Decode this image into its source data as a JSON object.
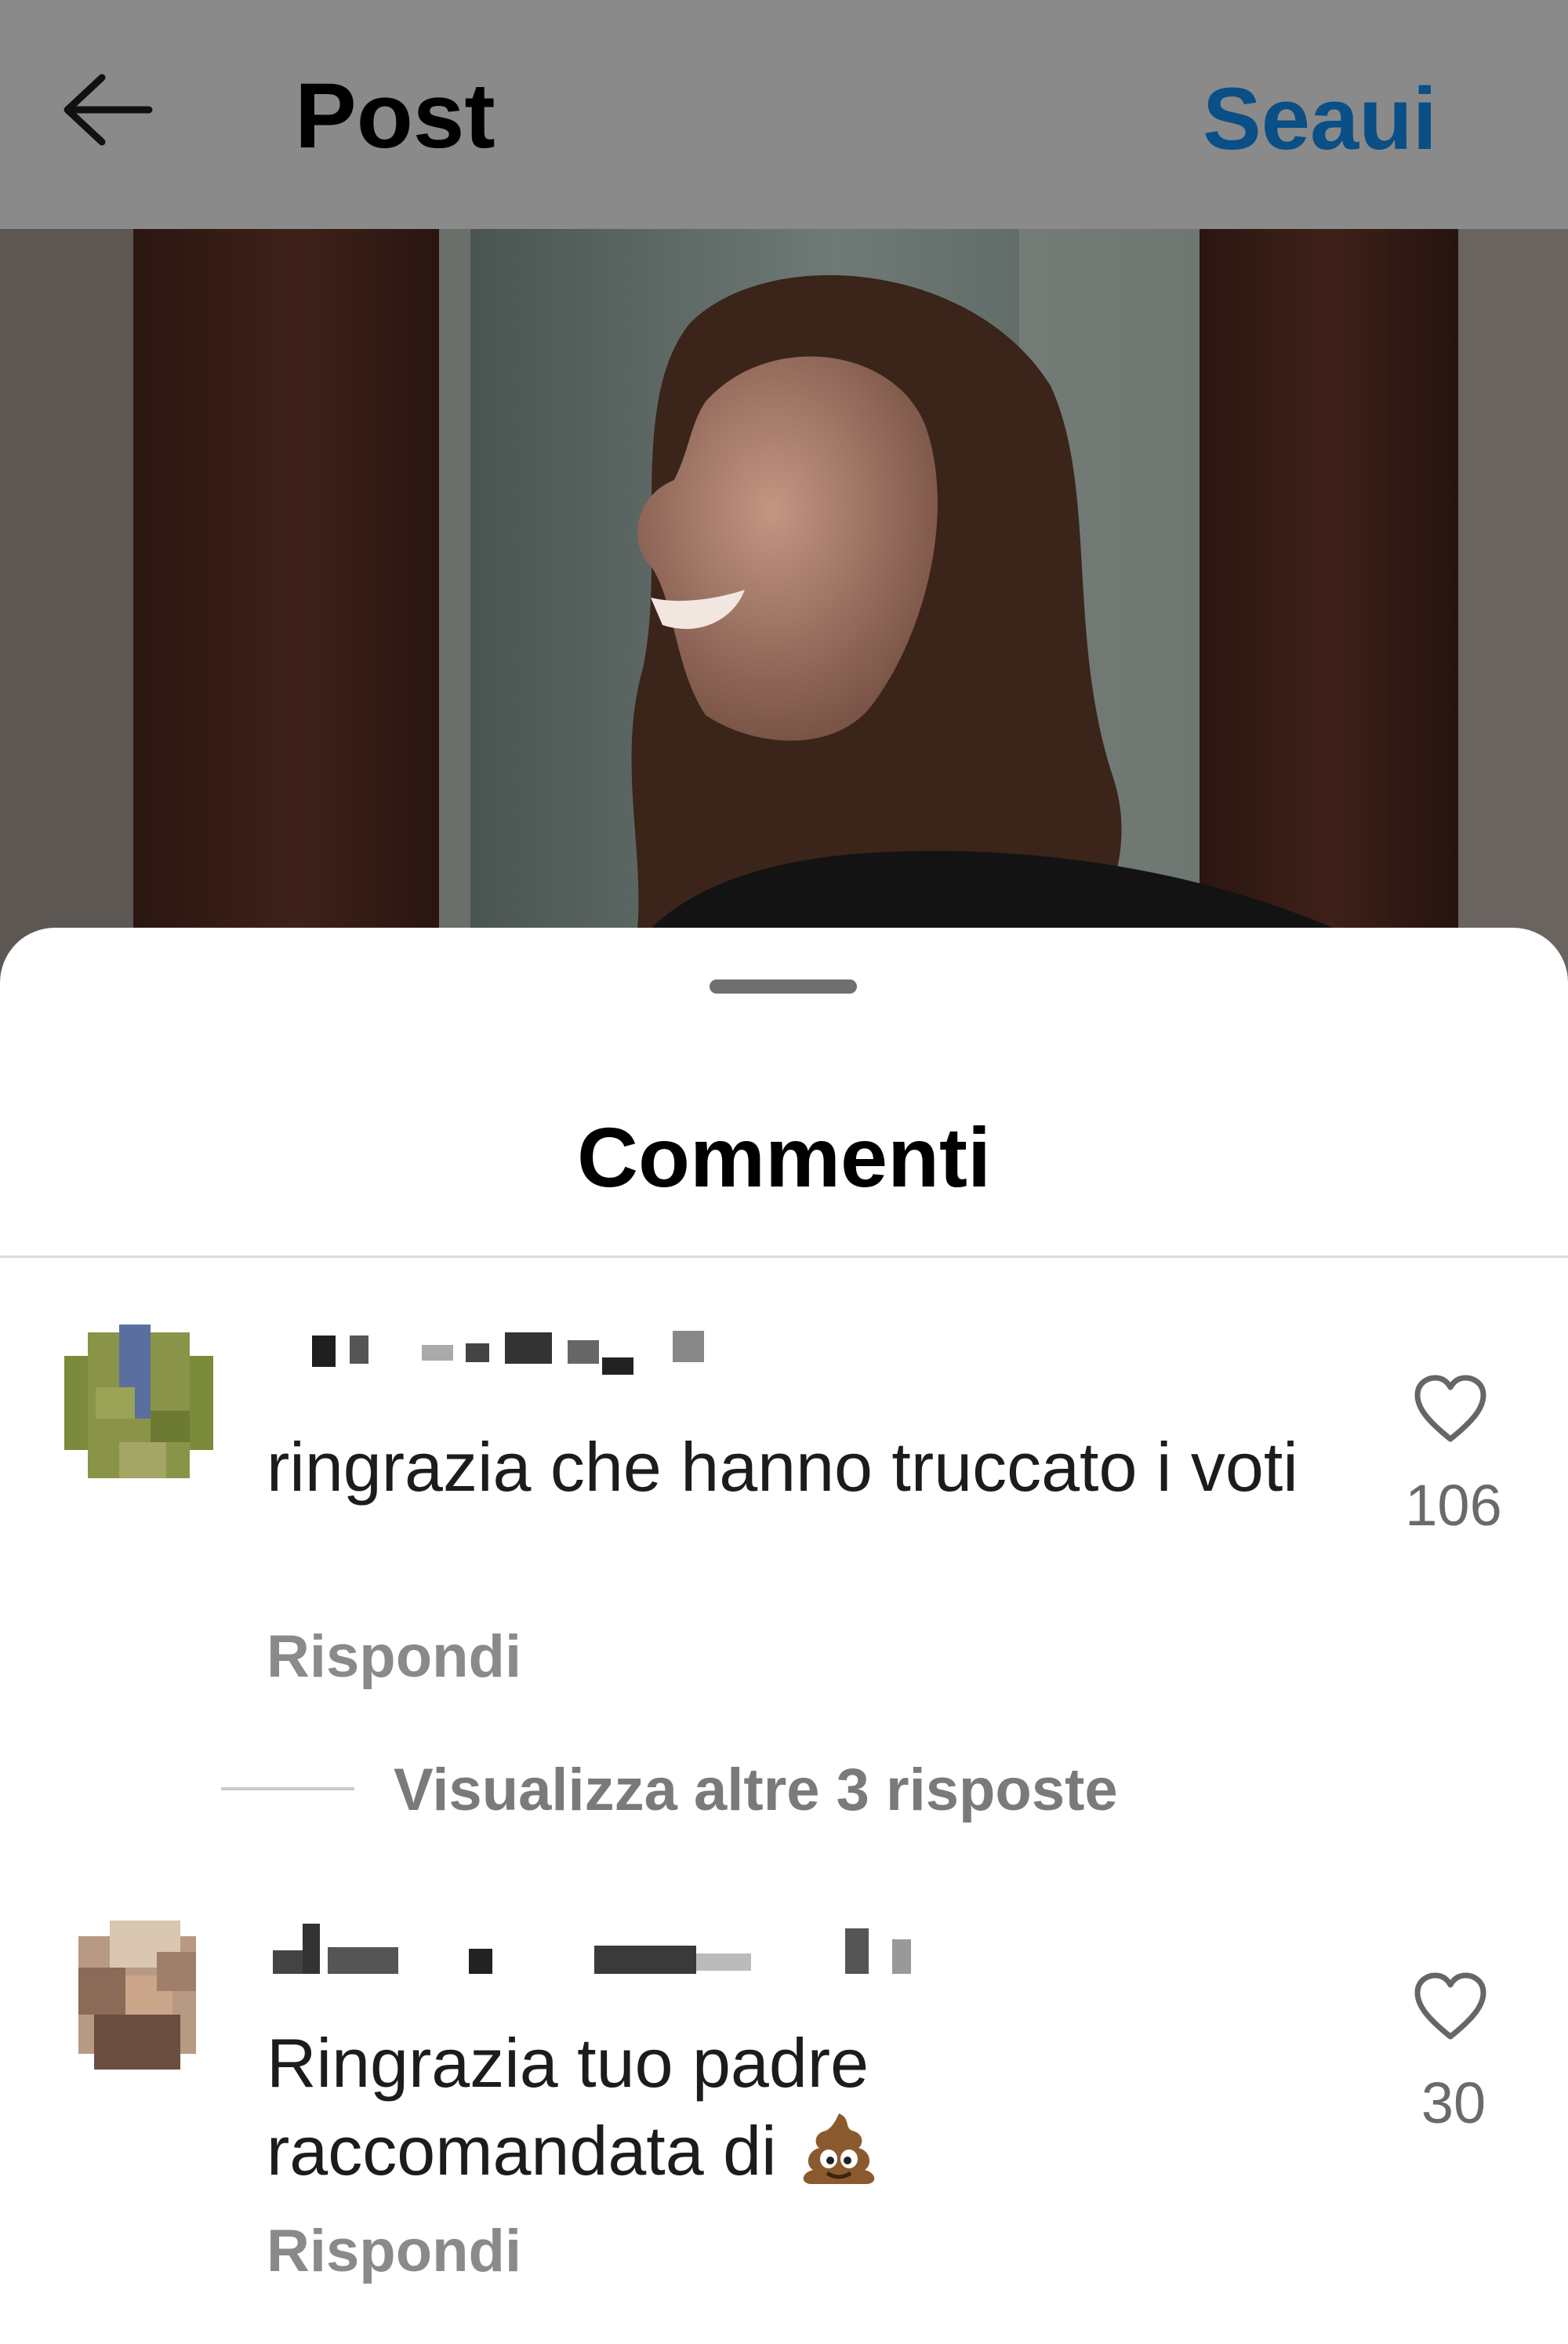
{
  "header": {
    "title": "Post",
    "follow_label": "Seaui"
  },
  "comments_sheet": {
    "title": "Commenti",
    "comments": [
      {
        "text": "ringrazia che hanno truccato i voti",
        "reply_label": "Rispondi",
        "like_count": "106",
        "view_replies_label": "Visualizza altre 3 risposte"
      },
      {
        "text": "Ringrazia tuo padre raccomandata di",
        "emoji": "pile-of-poo",
        "reply_label": "Rispondi",
        "like_count": "30"
      }
    ]
  },
  "colors": {
    "header_bg": "#8a8a8a",
    "follow_blue": "#0a4f86",
    "secondary_text": "#8a8a8a"
  }
}
